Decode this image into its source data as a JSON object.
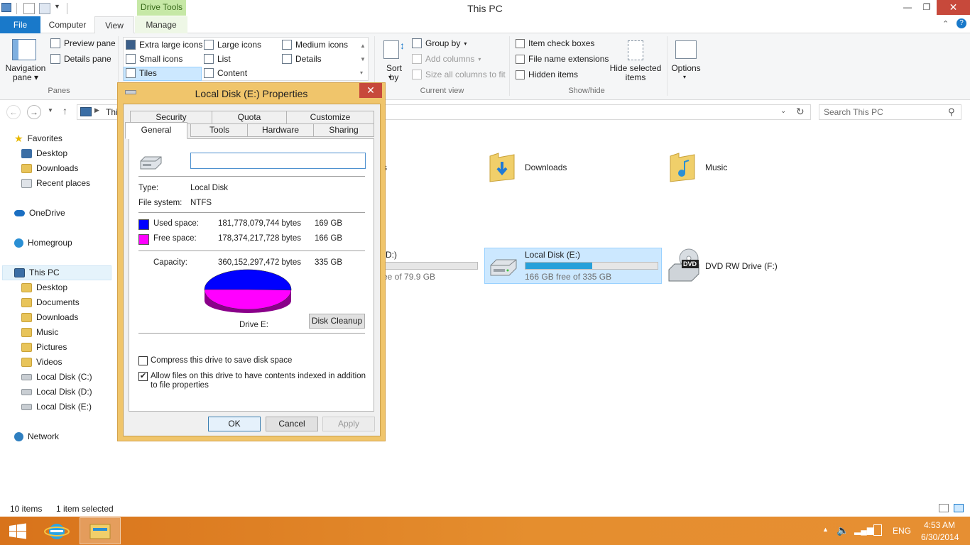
{
  "window": {
    "title": "This PC",
    "context_tab": "Drive Tools",
    "minimize": "—",
    "maximize": "❐",
    "close": "✕"
  },
  "ribbon_tabs": [
    "File",
    "Computer",
    "View",
    "Manage"
  ],
  "ribbon": {
    "panes": {
      "navigation_pane": "Navigation pane",
      "preview_pane": "Preview pane",
      "details_pane": "Details pane",
      "group_label": "Panes"
    },
    "layout": {
      "items": [
        "Extra large icons",
        "Large icons",
        "Medium icons",
        "Small icons",
        "List",
        "Details",
        "Tiles",
        "Content"
      ],
      "selected": "Tiles"
    },
    "current_view": {
      "sort_by": "Sort by",
      "group_by": "Group by",
      "add_columns": "Add columns",
      "size_columns": "Size all columns to fit",
      "group_label": "Current view"
    },
    "show_hide": {
      "item_check_boxes": "Item check boxes",
      "file_name_extensions": "File name extensions",
      "hidden_items": "Hidden items",
      "hide_selected": "Hide selected items",
      "group_label": "Show/hide"
    },
    "options": "Options"
  },
  "address": {
    "path_fragment": "Thi",
    "search_placeholder": "Search This PC"
  },
  "nav_pane": {
    "favorites": "Favorites",
    "favorites_items": [
      "Desktop",
      "Downloads",
      "Recent places"
    ],
    "onedrive": "OneDrive",
    "homegroup": "Homegroup",
    "this_pc": "This PC",
    "this_pc_items": [
      "Desktop",
      "Documents",
      "Downloads",
      "Music",
      "Pictures",
      "Videos",
      "Local Disk (C:)",
      "Local Disk (D:)",
      "Local Disk (E:)"
    ],
    "network": "Network"
  },
  "content": {
    "folders_partial": "s",
    "downloads": "Downloads",
    "music": "Music",
    "drive_d_partial_name": "(D:)",
    "drive_d_partial_free": "ee of 79.9 GB",
    "drive_e_name": "Local Disk (E:)",
    "drive_e_free": "166 GB free of 335 GB",
    "drive_e_used_fraction": 0.505,
    "dvd_name": "DVD RW Drive (F:)",
    "dvd_badge": "DVD"
  },
  "status": {
    "item_count": "10 items",
    "selected": "1 item selected"
  },
  "taskbar": {
    "language": "ENG",
    "time": "4:53 AM",
    "date": "6/30/2014"
  },
  "dialog": {
    "title": "Local Disk (E:) Properties",
    "close": "✕",
    "tabs_row1": [
      "Security",
      "Quota",
      "Customize"
    ],
    "tabs_row2": [
      "General",
      "Tools",
      "Hardware",
      "Sharing"
    ],
    "active_tab": "General",
    "label_value": "",
    "type_label": "Type:",
    "type_value": "Local Disk",
    "fs_label": "File system:",
    "fs_value": "NTFS",
    "used_label": "Used space:",
    "used_bytes": "181,778,079,744 bytes",
    "used_gb": "169 GB",
    "used_color": "#0000ff",
    "free_label": "Free space:",
    "free_bytes": "178,374,217,728 bytes",
    "free_gb": "166 GB",
    "free_color": "#ff00ff",
    "capacity_label": "Capacity:",
    "capacity_bytes": "360,152,297,472 bytes",
    "capacity_gb": "335 GB",
    "drive_caption": "Drive E:",
    "disk_cleanup": "Disk Cleanup",
    "compress": "Compress this drive to save disk space",
    "compress_checked": false,
    "index": "Allow files on this drive to have contents indexed in addition to file properties",
    "index_checked": true,
    "ok": "OK",
    "cancel": "Cancel",
    "apply": "Apply"
  }
}
